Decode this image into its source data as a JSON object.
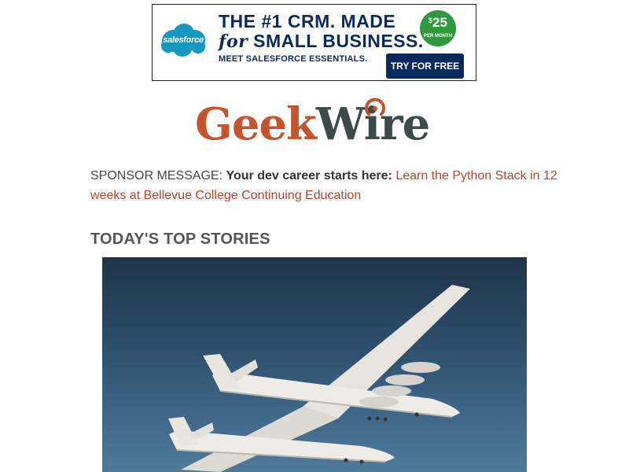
{
  "ad": {
    "brand": "salesforce",
    "headline_line1": "THE #1 CRM. MADE",
    "headline_for": "for",
    "headline_line2": "SMALL BUSINESS.",
    "subline": "MEET SALESFORCE ESSENTIALS.",
    "price_currency": "$",
    "price_amount": "25",
    "price_period": "PER MONTH",
    "cta_label": "TRY FOR FREE",
    "colors": {
      "navy": "#0a2a5e",
      "cloud": "#1798c1",
      "price": "#2e9a3c"
    }
  },
  "logo": {
    "part1": "Geek",
    "part2": "Wire",
    "colors": {
      "geek": "#c8532a",
      "wire": "#3d4a4a"
    }
  },
  "sponsor": {
    "label": "SPONSOR MESSAGE:",
    "bold_text": "Your dev career starts here:",
    "link_text": "Learn the Python Stack in 12 weeks at Bellevue College Continuing Education",
    "link_color": "#b4472a"
  },
  "section": {
    "title": "TODAY'S TOP STORIES"
  },
  "hero": {
    "icon": "aircraft-photo"
  }
}
